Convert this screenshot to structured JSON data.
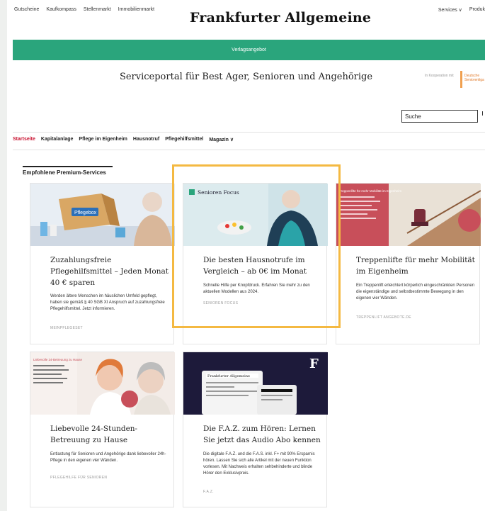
{
  "header": {
    "top_links": [
      "Gutscheine",
      "Kaufkompass",
      "Stellenmarkt",
      "Immobilienmarkt"
    ],
    "logo": "Frankfurter Allgemeine",
    "right_links": [
      "Services ∨",
      "Produk"
    ]
  },
  "banner": {
    "label": "Verlagsangebot"
  },
  "portal": {
    "title": "Serviceportal für Best Ager, Senioren und Angehörige",
    "cooperation": "In Kooperation mit",
    "partner": "Deutsche Seniorenliga"
  },
  "search": {
    "placeholder": "Suche"
  },
  "nav": {
    "items": [
      "Startseite",
      "Kapitalanlage",
      "Pflege im Eigenheim",
      "Hausnotruf",
      "Pflegehilfsmittel",
      "Magazin ∨"
    ]
  },
  "section": {
    "title": "Empfohlene Premium-Services"
  },
  "cards": [
    {
      "title": "Zuzahlungsfreie Pflegehilfsmittel – Jeden Monat 40 € sparen",
      "description": "Werden ältere Menschen im häuslichen Umfeld gepflegt, haben sie gemäß § 40 SGB XI Anspruch auf zuzahlungsfreie Pflegehilfsmittel. Jetzt informieren.",
      "source": "MEINPFLEGESET",
      "image_label": "Pflegebox"
    },
    {
      "title": "Die besten Hausnotrufe im Vergleich – ab 0€ im Monat",
      "description": "Schnelle Hilfe per Knopfdruck. Erfahren Sie mehr zu den aktuellen Modellen aus 2024.",
      "source": "SENIOREN FOCUS",
      "image_label": "Senioren Focus"
    },
    {
      "title": "Treppenlifte für mehr Mobilität im Eigenheim",
      "description": "Ein Treppenlift erleichtert körperlich eingeschränkten Personen die eigenständige und selbstbestimmte Bewegung in den eigenen vier Wänden.",
      "source": "TREPPENLIFT ANGEBOTE.DE",
      "image_label": "Treppenlifte für mehr Mobilität im Eigenheim"
    },
    {
      "title": "Liebevolle 24-Stunden-Betreuung zu Hause",
      "description": "Entlastung für Senioren und Angehörige dank liebevoller 24h-Pflege in den eigenen vier Wänden.",
      "source": "PFLEGEHILFE FÜR SENIOREN",
      "image_label": "Liebevolle 24-Betreuung zu Hause"
    },
    {
      "title": "Die F.A.Z. zum Hören: Lernen Sie jetzt das Audio Abo kennen",
      "description": "Die digitale F.A.Z. und die F.A.S. inkl. F+ mit 90% Ersparnis hören. Lassen Sie sich alle Artikel mit der neuen Funktion vorlesen. Mit Nachweis erhalten sehbehinderte und blinde Hörer den Exklusivpreis.",
      "source": "F.A.Z.",
      "image_label": "Frankfurter Allgemeine"
    }
  ],
  "colors": {
    "brand_green": "#2aa57c",
    "nav_active": "#c8102e",
    "highlight": "#f4b942"
  }
}
